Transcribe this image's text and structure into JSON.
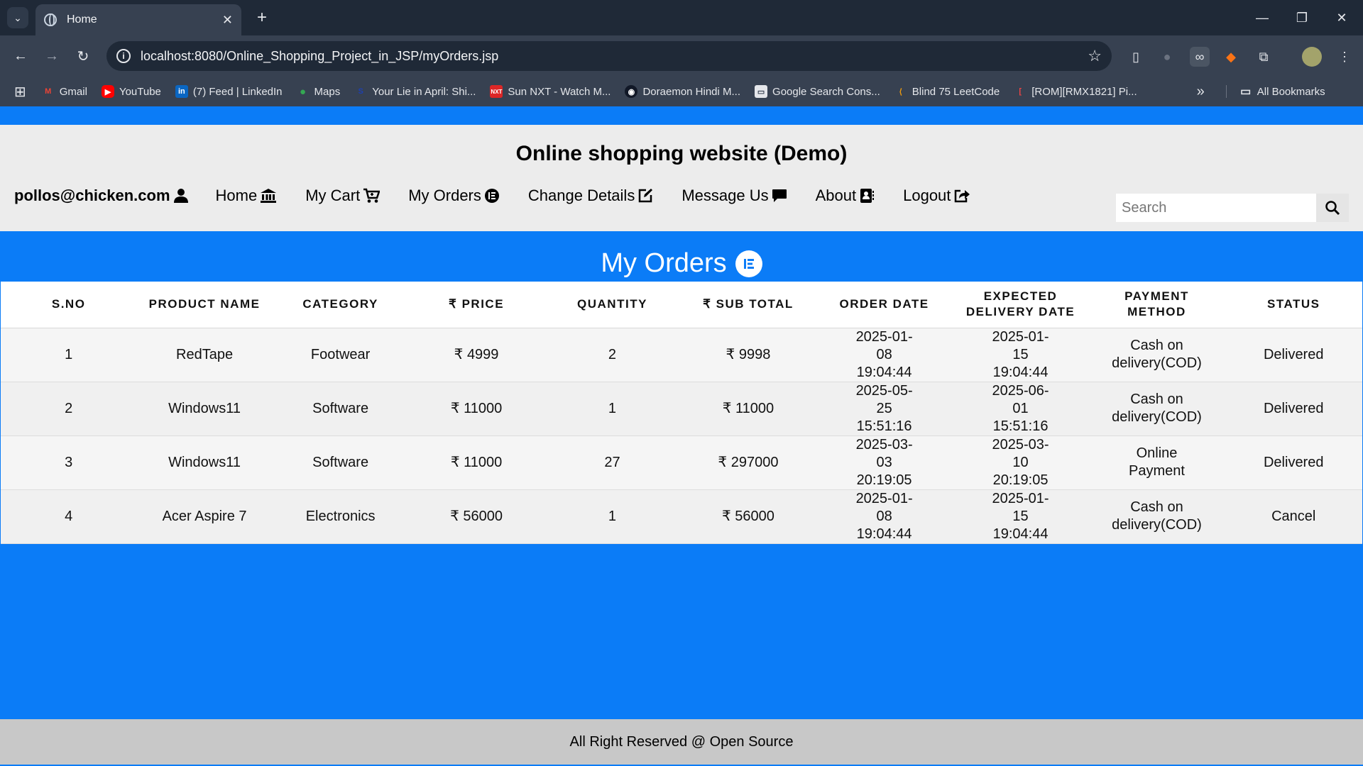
{
  "browser": {
    "tab_title": "Home",
    "url": "localhost:8080/Online_Shopping_Project_in_JSP/myOrders.jsp",
    "bookmarks": [
      "Gmail",
      "YouTube",
      "(7) Feed | LinkedIn",
      "Maps",
      "Your Lie in April: Shi...",
      "Sun NXT - Watch M...",
      "Doraemon Hindi M...",
      "Google Search Cons...",
      "Blind 75 LeetCode",
      "[ROM][RMX1821] Pi..."
    ],
    "all_bookmarks": "All Bookmarks"
  },
  "site": {
    "title": "Online shopping website (Demo)",
    "user": "pollos@chicken.com",
    "nav": [
      "Home",
      "My Cart",
      "My Orders",
      "Change Details",
      "Message Us",
      "About",
      "Logout"
    ],
    "search_placeholder": "Search"
  },
  "orders": {
    "heading": "My Orders",
    "headers": [
      "S.NO",
      "PRODUCT NAME",
      "CATEGORY",
      "₹ PRICE",
      "QUANTITY",
      "₹ SUB TOTAL",
      "ORDER DATE",
      "EXPECTED DELIVERY DATE",
      "PAYMENT METHOD",
      "STATUS"
    ],
    "rows": [
      [
        "1",
        "RedTape",
        "Footwear",
        "₹ 4999",
        "2",
        "₹ 9998",
        "2025-01-08 19:04:44",
        "2025-01-15 19:04:44",
        "Cash on delivery(COD)",
        "Delivered"
      ],
      [
        "2",
        "Windows11",
        "Software",
        "₹ 11000",
        "1",
        "₹ 11000",
        "2025-05-25 15:51:16",
        "2025-06-01 15:51:16",
        "Cash on delivery(COD)",
        "Delivered"
      ],
      [
        "3",
        "Windows11",
        "Software",
        "₹ 11000",
        "27",
        "₹ 297000",
        "2025-03-03 20:19:05",
        "2025-03-10 20:19:05",
        "Online Payment",
        "Delivered"
      ],
      [
        "4",
        "Acer Aspire 7",
        "Electronics",
        "₹ 56000",
        "1",
        "₹ 56000",
        "2025-01-08 19:04:44",
        "2025-01-15 19:04:44",
        "Cash on delivery(COD)",
        "Cancel"
      ]
    ]
  },
  "footer": "All Right Reserved @ Open Source",
  "colors": {
    "page_bg": "#0b7cf7",
    "header_bg": "#ececec",
    "footer_bg": "#c8c8c8",
    "chrome_dark": "#1f2937",
    "chrome": "#374151"
  }
}
